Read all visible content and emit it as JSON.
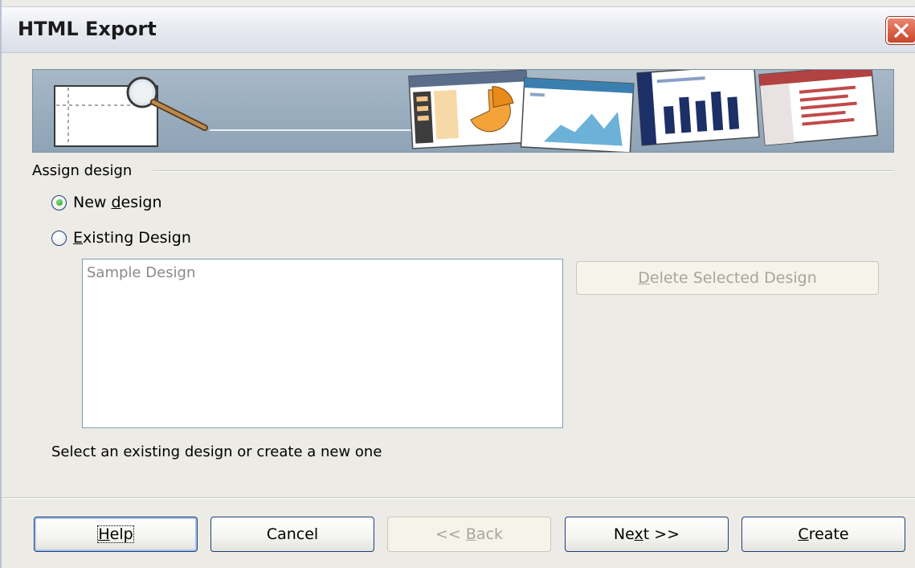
{
  "window": {
    "title": "HTML Export"
  },
  "icons": {
    "close": "close-icon",
    "banner_magnifier": "magnifier-icon"
  },
  "assign_design": {
    "legend": "Assign design",
    "new_design": {
      "label_prefix": "New ",
      "label_mnemonic": "d",
      "label_suffix": "esign",
      "checked": true
    },
    "existing_design": {
      "label_prefix": "",
      "label_mnemonic": "E",
      "label_suffix": "xisting Design",
      "checked": false
    },
    "designs": [
      "Sample Design"
    ],
    "delete_button": {
      "label_mnemonic": "D",
      "label_suffix": "elete Selected Design",
      "enabled": false
    }
  },
  "hint": "Select an existing design or create a new one",
  "buttons": {
    "help": {
      "label_mnemonic": "H",
      "label_suffix": "elp"
    },
    "cancel": {
      "label": "Cancel"
    },
    "back": {
      "label_prefix": "<< ",
      "label_mnemonic": "B",
      "label_suffix": "ack",
      "enabled": false
    },
    "next": {
      "label_prefix": "Ne",
      "label_mnemonic": "x",
      "label_suffix": "t >>"
    },
    "create": {
      "label_mnemonic": "C",
      "label_suffix": "reate"
    }
  },
  "colors": {
    "accent_border": "#1f3f7a",
    "close_red": "#c9452b",
    "radio_green": "#21a121"
  }
}
